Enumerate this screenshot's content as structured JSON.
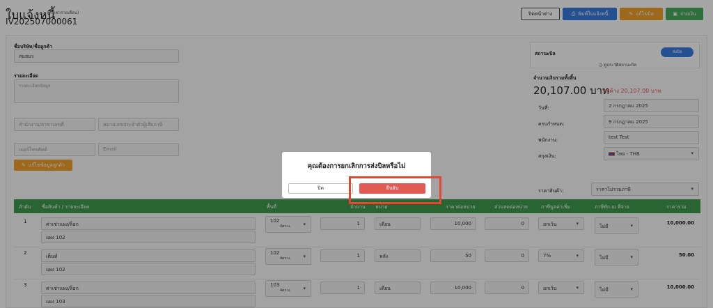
{
  "header": {
    "title": "ใบแจ้งหนี้",
    "title_sub": "(ค่าเช่ารายเดือน)",
    "invoice_no": "IV202507000061",
    "btn_close": "ปิดหน้าต่าง",
    "btn_print": "พิมพ์ใบแจ้งหนี้",
    "btn_edit": "แก้ไขบิล",
    "btn_pay": "จ่ายเงิน"
  },
  "customer": {
    "label": "ชื่อบริษัท/ชื่อลูกค้า",
    "name": "สมสมร",
    "detail_label": "รายละเอียด",
    "detail_placeholder": "รายละเอียดข้อมูล",
    "branch_placeholder": "สำนักงาน/สาขาเลขที่",
    "taxid_placeholder": "หมายเลขประจำตัวผู้เสียภาษี",
    "phone_placeholder": "เบอร์โทรศัพท์",
    "email_placeholder": "Email",
    "edit_btn": "แก้ไขข้อมูลลูกค้า"
  },
  "status": {
    "label": "สถานะบิล",
    "badge": "ส่งบิล",
    "history": "ดูประวัติสถานะบิล"
  },
  "totals": {
    "label": "จำนวนเงินรวมทั้งสิ้น",
    "amount": "20,107.00 บาท",
    "outstanding": "คงค้าง 20,107.00 บาท"
  },
  "meta": {
    "date_label": "วันที่:",
    "date_value": "2 กรกฎาคม 2025",
    "due_label": "ครบกำหนด:",
    "due_value": "9 กรกฎาคม 2025",
    "staff_label": "พนักงาน:",
    "staff_value": "test Test",
    "currency_label": "สกุลเงิน:",
    "currency_value": "ไทย - THB",
    "price_label": "ราคาสินค้า:",
    "price_value": "ราคาไม่รวมภาษี"
  },
  "table": {
    "headers": [
      "ลำดับ",
      "ชื่อสินค้า / รายละเอียด",
      "พื้นที่",
      "จำนวน",
      "หน่วย",
      "ราคาต่อหน่วย",
      "ส่วนลดต่อหน่วย",
      "ภาษีมูลค่าเพิ่ม",
      "ภาษีหัก ณ ที่จ่าย",
      "ราคารวม"
    ],
    "rows": [
      {
        "no": "1",
        "name": "ค่าเช่าแผง/ล็อก",
        "detail": "แผง 102",
        "area": "102",
        "area_sub": "4ตร.ม.",
        "qty": "1",
        "unit": "เดือน",
        "price": "10,000",
        "discount": "0",
        "vat": "ยกเว้น",
        "wht": "ไม่มี",
        "total": "10,000.00"
      },
      {
        "no": "2",
        "name": "เต็นท์",
        "detail": "แผง 102",
        "area": "102",
        "area_sub": "4ตร.ม.",
        "qty": "1",
        "unit": "หลัง",
        "price": "50",
        "discount": "0",
        "vat": "7%",
        "wht": "ไม่มี",
        "total": "50.00"
      },
      {
        "no": "3",
        "name": "ค่าเช่าแผง/ล็อก",
        "detail": "แผง 103",
        "area": "103",
        "area_sub": "4ตร.ม.",
        "qty": "1",
        "unit": "เดือน",
        "price": "10,000",
        "discount": "0",
        "vat": "ยกเว้น",
        "wht": "ไม่มี",
        "total": "10,000.00"
      }
    ]
  },
  "modal": {
    "title": "คุณต้องการยกเลิกการส่งบิลหรือไม่",
    "close": "ปิด",
    "confirm": "ยืนยัน"
  },
  "colors": {
    "green": "#3f9a4f",
    "blue": "#3a7be0",
    "orange": "#f0a02a",
    "red": "#e05a55",
    "highlight": "#e8452f"
  }
}
